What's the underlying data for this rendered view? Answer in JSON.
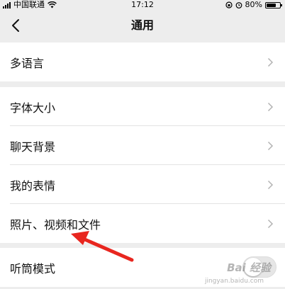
{
  "status_bar": {
    "carrier": "中国联通",
    "time": "17:12",
    "battery": "80%",
    "battery_level": 0.8
  },
  "nav": {
    "title": "通用"
  },
  "groups": [
    {
      "items": [
        {
          "label": "多语言"
        }
      ]
    },
    {
      "items": [
        {
          "label": "字体大小"
        },
        {
          "label": "聊天背景"
        },
        {
          "label": "我的表情"
        },
        {
          "label": "照片、视频和文件"
        }
      ]
    },
    {
      "items": [
        {
          "label": "听筒模式",
          "toggle": false
        }
      ]
    }
  ],
  "watermark": {
    "text": "Bai 经验",
    "sub": "jingyan.baidu.com"
  },
  "colors": {
    "background": "#ededed",
    "row_background": "#ffffff",
    "annotation_arrow": "#e8261f"
  }
}
